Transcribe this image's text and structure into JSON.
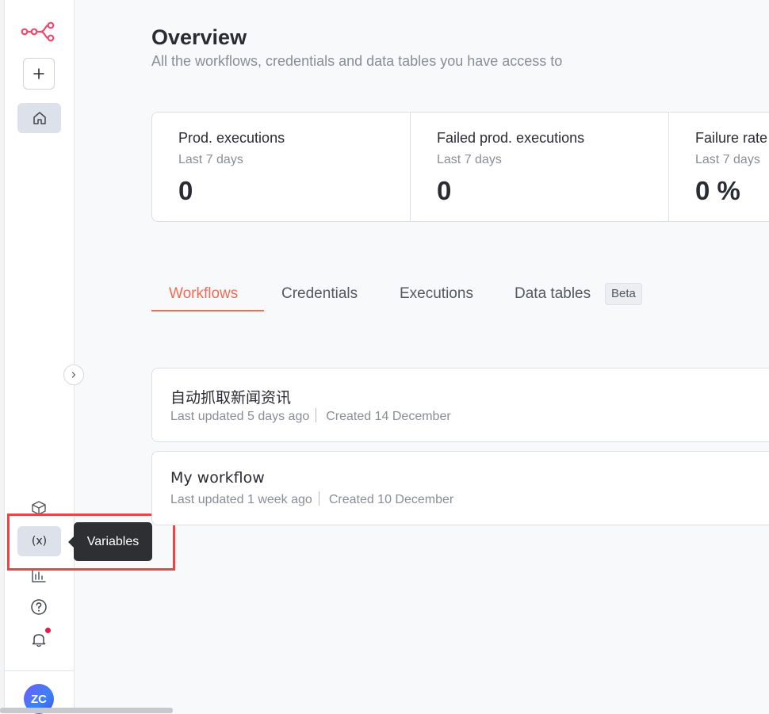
{
  "sidebar": {
    "user_initials": "ZC"
  },
  "tooltip": {
    "text": "Variables"
  },
  "page": {
    "title": "Overview",
    "subtitle": "All the workflows, credentials and data tables you have access to"
  },
  "stats": [
    {
      "label": "Prod. executions",
      "period": "Last 7 days",
      "value": "0"
    },
    {
      "label": "Failed prod. executions",
      "period": "Last 7 days",
      "value": "0"
    },
    {
      "label": "Failure rate",
      "period": "Last 7 days",
      "value": "0 %"
    }
  ],
  "tabs": {
    "workflows": "Workflows",
    "credentials": "Credentials",
    "executions": "Executions",
    "data_tables": "Data tables",
    "data_tables_badge": "Beta"
  },
  "workflows": [
    {
      "name": "自动抓取新闻资讯",
      "updated": "Last updated 5 days ago",
      "created": "Created 14 December"
    },
    {
      "name": "My workflow",
      "updated": "Last updated 1 week ago",
      "created": "Created 10 December"
    }
  ],
  "colors": {
    "accent": "#ee6d55",
    "logo": "#ea4b71",
    "highlight": "#ef4444",
    "notification_dot": "#e11d48"
  }
}
